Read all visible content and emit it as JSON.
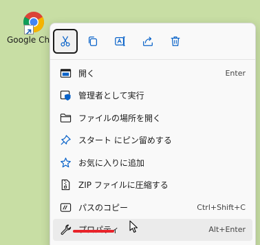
{
  "desktop": {
    "icon_label": "Google Chr",
    "icon_name": "chrome-icon"
  },
  "toolbar": {
    "buttons": [
      {
        "name": "cut",
        "icon": "scissors-icon",
        "active": true
      },
      {
        "name": "copy",
        "icon": "copy-icon"
      },
      {
        "name": "rename",
        "icon": "rename-icon"
      },
      {
        "name": "share",
        "icon": "share-icon"
      },
      {
        "name": "delete",
        "icon": "trash-icon"
      }
    ]
  },
  "menu": {
    "items": [
      {
        "label": "開く",
        "shortcut": "Enter",
        "icon": "open-window-icon"
      },
      {
        "label": "管理者として実行",
        "shortcut": "",
        "icon": "shield-icon"
      },
      {
        "label": "ファイルの場所を開く",
        "shortcut": "",
        "icon": "folder-icon"
      },
      {
        "label": "スタート にピン留めする",
        "shortcut": "",
        "icon": "pin-icon"
      },
      {
        "label": "お気に入りに追加",
        "shortcut": "",
        "icon": "star-icon"
      },
      {
        "label": "ZIP ファイルに圧縮する",
        "shortcut": "",
        "icon": "zip-icon"
      },
      {
        "label": "パスのコピー",
        "shortcut": "Ctrl+Shift+C",
        "icon": "path-copy-icon"
      },
      {
        "label": "プロパティ",
        "shortcut": "Alt+Enter",
        "icon": "wrench-icon",
        "highlight": true
      }
    ]
  },
  "colors": {
    "desktop_bg": "#c8dea4",
    "menu_bg": "#f9f9f9",
    "highlight_bg": "#ebebeb",
    "annotation_underline": "#e8232a",
    "accent_blue": "#0a63c9"
  }
}
